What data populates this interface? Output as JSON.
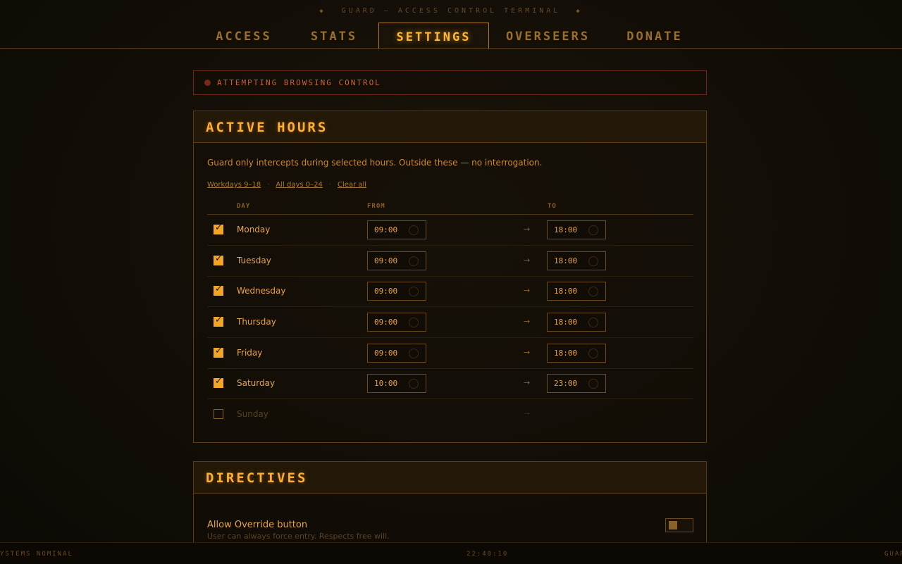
{
  "header": {
    "title": "GUARD — ACCESS CONTROL TERMINAL",
    "diamond_left": "◆",
    "diamond_right": "◆"
  },
  "tabs": [
    {
      "label": "ACCESS",
      "active": false
    },
    {
      "label": "STATS",
      "active": false
    },
    {
      "label": "SETTINGS",
      "active": true
    },
    {
      "label": "OVERSEERS",
      "active": false
    },
    {
      "label": "DONATE",
      "active": false
    }
  ],
  "alert": {
    "text": "ATTEMPTING BROWSING CONTROL"
  },
  "active_hours": {
    "title": "ACTIVE HOURS",
    "description": "Guard only intercepts during selected hours. Outside these — no interrogation.",
    "presets": [
      "Workdays 9–18",
      "All days 0–24",
      "Clear all"
    ],
    "columns": {
      "day": "DAY",
      "from": "FROM",
      "to": "TO"
    },
    "arrow": "→",
    "rows": [
      {
        "day": "Monday",
        "checked": true,
        "from": "09:00",
        "to": "18:00"
      },
      {
        "day": "Tuesday",
        "checked": true,
        "from": "09:00",
        "to": "18:00"
      },
      {
        "day": "Wednesday",
        "checked": true,
        "from": "09:00",
        "to": "18:00"
      },
      {
        "day": "Thursday",
        "checked": true,
        "from": "09:00",
        "to": "18:00"
      },
      {
        "day": "Friday",
        "checked": true,
        "from": "09:00",
        "to": "18:00"
      },
      {
        "day": "Saturday",
        "checked": true,
        "from": "10:00",
        "to": "23:00"
      },
      {
        "day": "Sunday",
        "checked": false,
        "from": "",
        "to": ""
      }
    ]
  },
  "directives": {
    "title": "DIRECTIVES",
    "override_label": "Allow Override button",
    "override_sub": "User can always force entry. Respects free will."
  },
  "status": {
    "left": "YSTEMS NOMINAL",
    "time": "22:40:10",
    "right": "GUAR"
  }
}
